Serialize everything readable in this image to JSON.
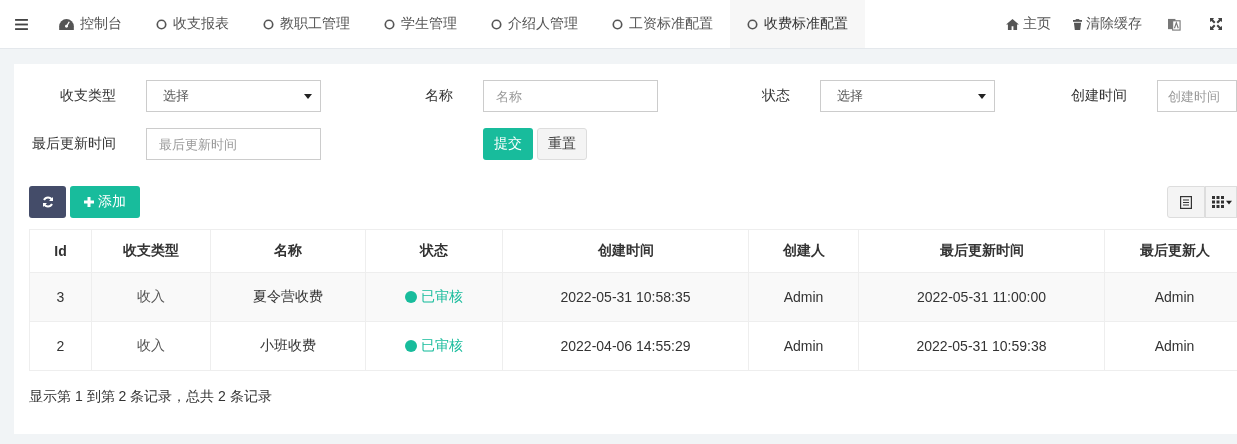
{
  "nav": {
    "tabs": [
      {
        "label": "控制台",
        "selected": false
      },
      {
        "label": "收支报表",
        "selected": false
      },
      {
        "label": "教职工管理",
        "selected": false
      },
      {
        "label": "学生管理",
        "selected": false
      },
      {
        "label": "介绍人管理",
        "selected": false
      },
      {
        "label": "工资标准配置",
        "selected": false
      },
      {
        "label": "收费标准配置",
        "selected": true
      }
    ],
    "links": [
      {
        "label": "主页"
      },
      {
        "label": "清除缓存"
      }
    ]
  },
  "filters": [
    {
      "label": "收支类型",
      "kind": "select",
      "value": "选择"
    },
    {
      "label": "名称",
      "kind": "input",
      "placeholder": "名称"
    },
    {
      "label": "状态",
      "kind": "select",
      "value": "选择"
    },
    {
      "label": "创建时间",
      "kind": "input",
      "placeholder": "创建时间"
    },
    {
      "label": "最后更新时间",
      "kind": "input",
      "placeholder": "最后更新时间"
    }
  ],
  "form_buttons": [
    {
      "label": "提交",
      "kind": "primary"
    },
    {
      "label": "重置",
      "kind": "default"
    }
  ],
  "toolbar": {
    "add_button": "添加"
  },
  "table": {
    "columns": [
      "Id",
      "收支类型",
      "名称",
      "状态",
      "创建时间",
      "创建人",
      "最后更新时间",
      "最后更新人"
    ],
    "rows": [
      {
        "id": "3",
        "type": "收入",
        "name": "夏令营收费",
        "status": {
          "label": "已审核",
          "color": "#18bc9c"
        },
        "created": "2022-05-31 10:58:35",
        "creator": "Admin",
        "updated": "2022-05-31 11:00:00",
        "updater": "Admin"
      },
      {
        "id": "2",
        "type": "收入",
        "name": "小班收费",
        "status": {
          "label": "已审核",
          "color": "#18bc9c"
        },
        "created": "2022-04-06 14:55:29",
        "creator": "Admin",
        "updated": "2022-05-31 10:59:38",
        "updater": "Admin"
      }
    ]
  },
  "pagination_info": "显示第 1 到第 2 条记录，总共 2 条记录"
}
